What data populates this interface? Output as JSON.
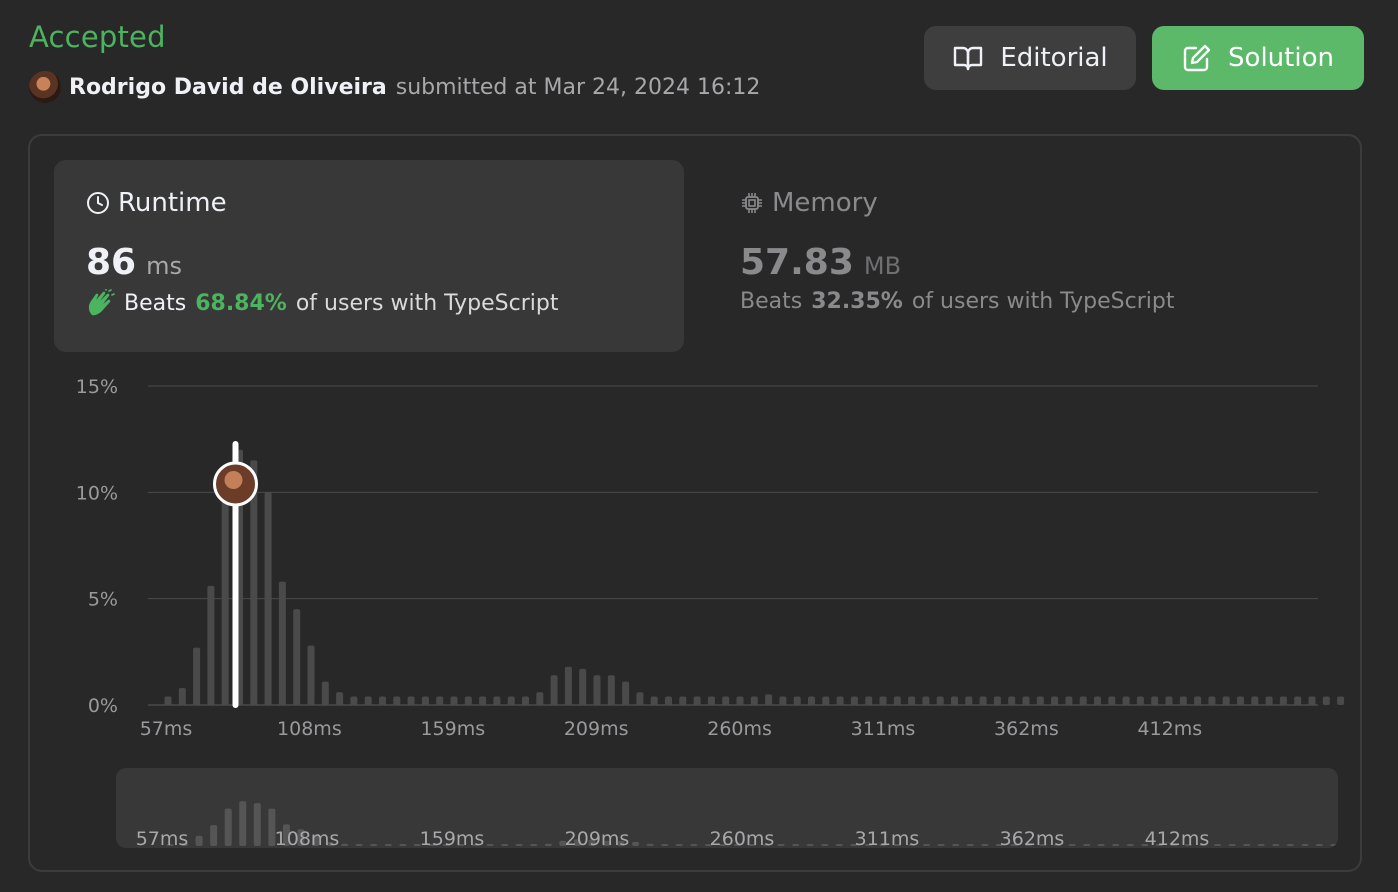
{
  "header": {
    "status": "Accepted",
    "submitter_name": "Rodrigo David de Oliveira",
    "submitted_text": "submitted at Mar 24, 2024 16:12",
    "editorial_label": "Editorial",
    "solution_label": "Solution"
  },
  "runtime": {
    "title": "Runtime",
    "value": "86",
    "unit": "ms",
    "beats_prefix": "Beats",
    "beats_pct": "68.84%",
    "beats_suffix": "of users with TypeScript"
  },
  "memory": {
    "title": "Memory",
    "value": "57.83",
    "unit": "MB",
    "beats_prefix": "Beats",
    "beats_pct": "32.35%",
    "beats_suffix": "of users with TypeScript"
  },
  "colors": {
    "accent_green": "#4cb35f",
    "button_green": "#5cb96a",
    "bar": "#4a4a4a",
    "grid": "#4a4a4a"
  },
  "chart_data": {
    "type": "bar",
    "title": "",
    "xlabel": "",
    "ylabel": "",
    "ylim": [
      0,
      15
    ],
    "y_ticks": [
      "0%",
      "5%",
      "10%",
      "15%"
    ],
    "x_tick_labels": [
      "57ms",
      "108ms",
      "159ms",
      "209ms",
      "260ms",
      "311ms",
      "362ms",
      "412ms"
    ],
    "grid": true,
    "highlight_value_ms": 86,
    "values": [
      0.4,
      0.8,
      2.7,
      5.6,
      10.0,
      12.0,
      11.5,
      10.0,
      5.8,
      4.5,
      2.8,
      1.1,
      0.6,
      0.4,
      0.4,
      0.4,
      0.4,
      0.4,
      0.4,
      0.4,
      0.4,
      0.4,
      0.4,
      0.4,
      0.4,
      0.4,
      0.6,
      1.4,
      1.8,
      1.7,
      1.4,
      1.4,
      1.1,
      0.6,
      0.4,
      0.4,
      0.4,
      0.4,
      0.4,
      0.4,
      0.4,
      0.4,
      0.5,
      0.4,
      0.4,
      0.4,
      0.4,
      0.4,
      0.4,
      0.4,
      0.4,
      0.4,
      0.4,
      0.4,
      0.4,
      0.4,
      0.4,
      0.4,
      0.4,
      0.4,
      0.4,
      0.4,
      0.4,
      0.4,
      0.4,
      0.4,
      0.4,
      0.4,
      0.4,
      0.4,
      0.4,
      0.4,
      0.4,
      0.4,
      0.4,
      0.4,
      0.4,
      0.4,
      0.4,
      0.4,
      0.4,
      0.4,
      0.4
    ]
  }
}
